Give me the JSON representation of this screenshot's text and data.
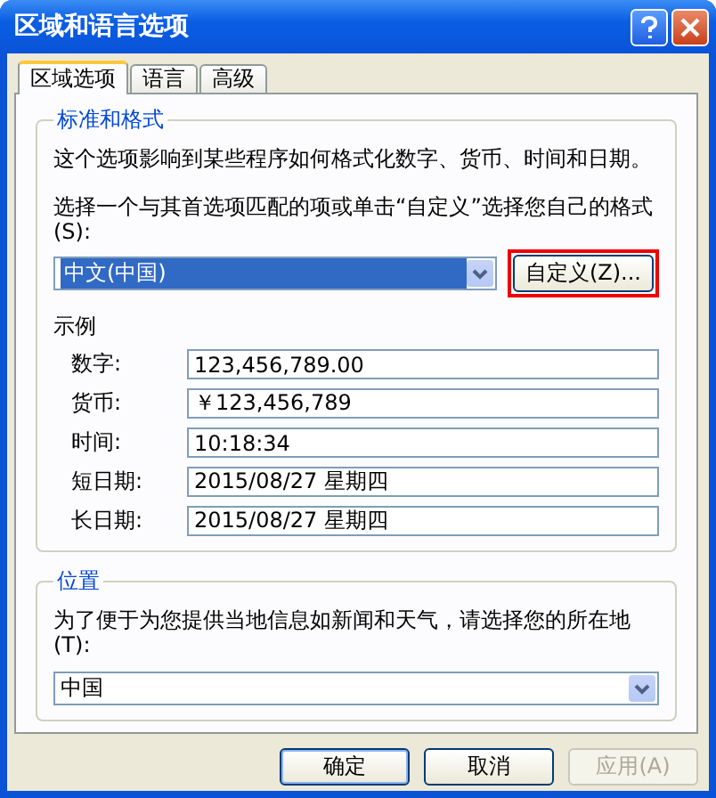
{
  "window": {
    "title": "区域和语言选项"
  },
  "tabs": [
    {
      "label": "区域选项",
      "selected": true
    },
    {
      "label": "语言",
      "selected": false
    },
    {
      "label": "高级",
      "selected": false
    }
  ],
  "format_group": {
    "title": "标准和格式",
    "description": "这个选项影响到某些程序如何格式化数字、货币、时间和日期。",
    "prompt": "选择一个与其首选项匹配的项或单击“自定义”选择您自己的格式(S):",
    "locale_select": {
      "value": "中文(中国)"
    },
    "customize_button": {
      "label": "自定义(Z)...",
      "highlighted": true
    }
  },
  "samples": {
    "title": "示例",
    "rows": [
      {
        "label": "数字:",
        "value": "123,456,789.00"
      },
      {
        "label": "货币:",
        "value": "￥123,456,789"
      },
      {
        "label": "时间:",
        "value": "10:18:34"
      },
      {
        "label": "短日期:",
        "value": "2015/08/27 星期四"
      },
      {
        "label": "长日期:",
        "value": "2015/08/27 星期四"
      }
    ]
  },
  "location_group": {
    "title": "位置",
    "prompt": "为了便于为您提供当地信息如新闻和天气，请选择您的所在地(T):",
    "select": {
      "value": "中国"
    }
  },
  "buttons": [
    {
      "label": "确定",
      "disabled": false,
      "default": true
    },
    {
      "label": "取消",
      "disabled": false,
      "default": false
    },
    {
      "label": "应用(A)",
      "disabled": true,
      "default": false
    }
  ]
}
